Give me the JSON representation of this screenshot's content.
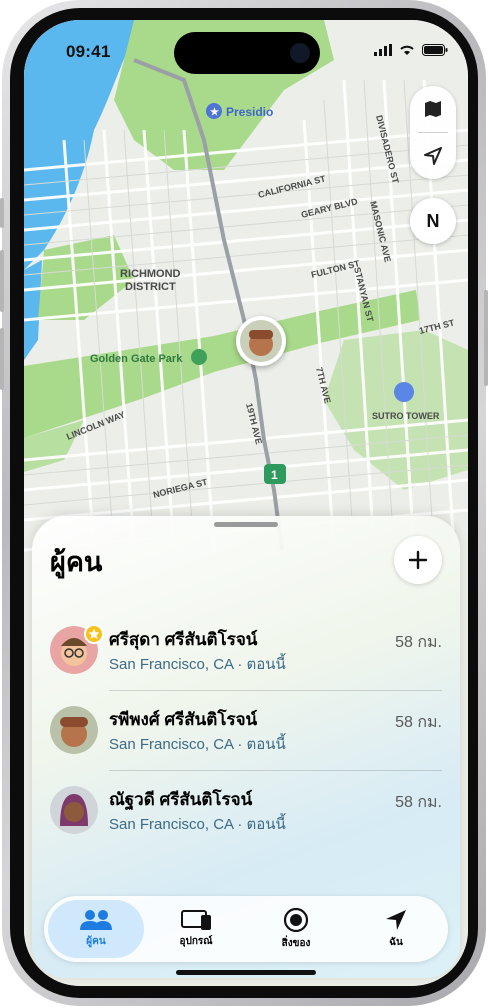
{
  "status_bar": {
    "time": "09:41"
  },
  "map": {
    "labels": {
      "presidio": "Presidio",
      "richmond_1": "RICHMOND",
      "richmond_2": "DISTRICT",
      "golden_gate_park": "Golden Gate Park",
      "california_st": "CALIFORNIA ST",
      "geary_blvd": "GEARY BLVD",
      "fulton_st": "FULTON ST",
      "divisadero_st": "DIVISADERO ST",
      "masonic_ave": "MASONIC AVE",
      "stanyan_st": "STANYAN ST",
      "seventeenth_st": "17TH ST",
      "seventh_ave": "7TH AVE",
      "nineteenth_ave": "19TH AVE",
      "lincoln_way": "LINCOLN WAY",
      "noriega_st": "NORIEGA ST",
      "sutro_tower": "SUTRO TOWER",
      "route_shield": "1"
    },
    "compass_label": "N"
  },
  "sheet": {
    "title": "ผู้คน",
    "people": [
      {
        "name": "ศรีสุดา ศรีสันติโรจน์",
        "location": "San Francisco, CA · ตอนนี้",
        "distance": "58 กม.",
        "favorite": true
      },
      {
        "name": "รพีพงศ์ ศรีสันติโรจน์",
        "location": "San Francisco, CA · ตอนนี้",
        "distance": "58 กม.",
        "favorite": false
      },
      {
        "name": "ณัฐวดี ศรีสันติโรจน์",
        "location": "San Francisco, CA · ตอนนี้",
        "distance": "58 กม.",
        "favorite": false
      }
    ]
  },
  "tabs": [
    {
      "label": "ผู้คน",
      "icon": "people-icon",
      "active": true
    },
    {
      "label": "อุปกรณ์",
      "icon": "devices-icon",
      "active": false
    },
    {
      "label": "สิ่งของ",
      "icon": "airtag-icon",
      "active": false
    },
    {
      "label": "ฉัน",
      "icon": "location-arrow-icon",
      "active": false
    }
  ],
  "colors": {
    "accent": "#1e7ce0",
    "park": "#a9d98a",
    "water": "#5ab8ee",
    "route": "#2f9a5e",
    "favorite": "#f6c21a"
  }
}
